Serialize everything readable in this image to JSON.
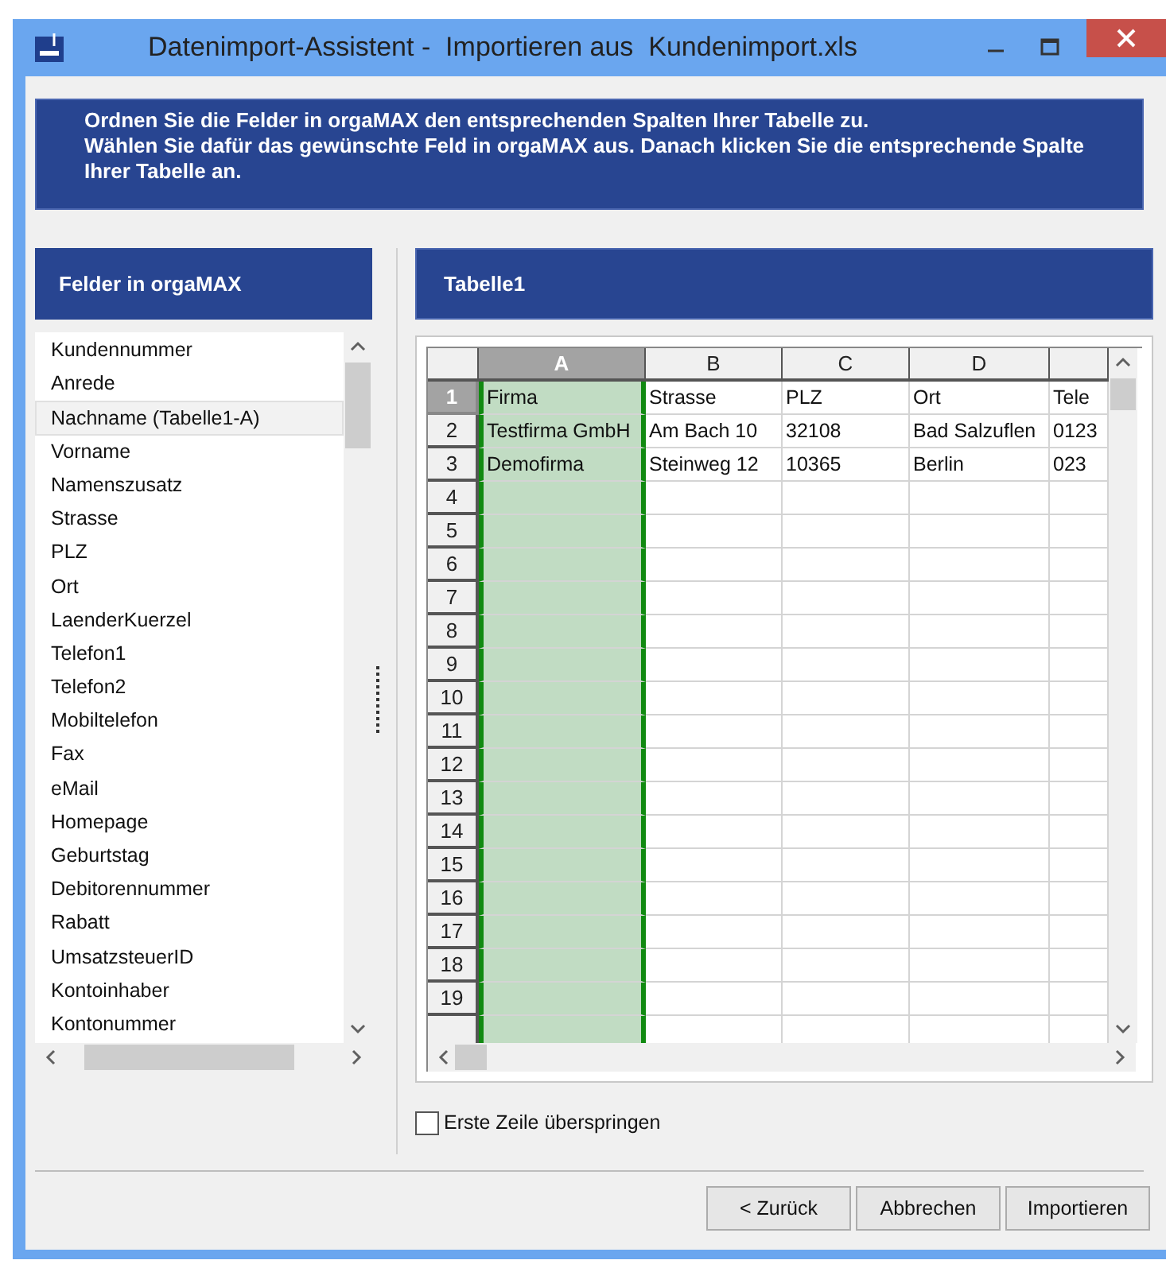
{
  "window": {
    "title": "Datenimport-Assistent -  Importieren aus  Kundenimport.xls"
  },
  "instructions": [
    "Ordnen Sie die Felder in orgaMAX den entsprechenden Spalten Ihrer Tabelle zu.",
    "Wählen Sie dafür das gewünschte Feld in orgaMAX aus. Danach klicken Sie die entsprechende Spalte Ihrer Tabelle an."
  ],
  "fields_panel": {
    "title": "Felder in orgaMAX",
    "items": [
      {
        "label": "Kundennummer",
        "selected": false
      },
      {
        "label": "Anrede",
        "selected": false
      },
      {
        "label": "Nachname (Tabelle1-A)",
        "selected": true
      },
      {
        "label": "Vorname",
        "selected": false
      },
      {
        "label": "Namenszusatz",
        "selected": false
      },
      {
        "label": "Strasse",
        "selected": false
      },
      {
        "label": "PLZ",
        "selected": false
      },
      {
        "label": "Ort",
        "selected": false
      },
      {
        "label": "LaenderKuerzel",
        "selected": false
      },
      {
        "label": "Telefon1",
        "selected": false
      },
      {
        "label": "Telefon2",
        "selected": false
      },
      {
        "label": "Mobiltelefon",
        "selected": false
      },
      {
        "label": "Fax",
        "selected": false
      },
      {
        "label": "eMail",
        "selected": false
      },
      {
        "label": "Homepage",
        "selected": false
      },
      {
        "label": "Geburtstag",
        "selected": false
      },
      {
        "label": "Debitorennummer",
        "selected": false
      },
      {
        "label": "Rabatt",
        "selected": false
      },
      {
        "label": "UmsatzsteuerID",
        "selected": false
      },
      {
        "label": "Kontoinhaber",
        "selected": false
      },
      {
        "label": "Kontonummer",
        "selected": false
      }
    ]
  },
  "sheet": {
    "title": "Tabelle1",
    "columns": [
      {
        "label": "A",
        "selected": true
      },
      {
        "label": "B",
        "selected": false
      },
      {
        "label": "C",
        "selected": false
      },
      {
        "label": "D",
        "selected": false
      }
    ],
    "rows": [
      {
        "number": "1",
        "selected": true,
        "cells": [
          "Firma",
          "Strasse",
          "PLZ",
          "Ort",
          "Tele"
        ]
      },
      {
        "number": "2",
        "selected": false,
        "cells": [
          "Testfirma GmbH",
          "Am Bach 10",
          "32108",
          "Bad Salzuflen",
          "0123"
        ]
      },
      {
        "number": "3",
        "selected": false,
        "cells": [
          "Demofirma",
          "Steinweg 12",
          "10365",
          "Berlin",
          "023"
        ]
      },
      {
        "number": "4",
        "selected": false
      },
      {
        "number": "5",
        "selected": false
      },
      {
        "number": "6",
        "selected": false
      },
      {
        "number": "7",
        "selected": false
      },
      {
        "number": "8",
        "selected": false
      },
      {
        "number": "9",
        "selected": false
      },
      {
        "number": "10",
        "selected": false
      },
      {
        "number": "11",
        "selected": false
      },
      {
        "number": "12",
        "selected": false
      },
      {
        "number": "13",
        "selected": false
      },
      {
        "number": "14",
        "selected": false
      },
      {
        "number": "15",
        "selected": false
      },
      {
        "number": "16",
        "selected": false
      },
      {
        "number": "17",
        "selected": false
      },
      {
        "number": "18",
        "selected": false
      },
      {
        "number": "19",
        "selected": false
      }
    ]
  },
  "skip_first_row": {
    "label": "Erste Zeile überspringen",
    "checked": false
  },
  "buttons": [
    "< Zurück",
    "Abbrechen",
    "Importieren"
  ]
}
